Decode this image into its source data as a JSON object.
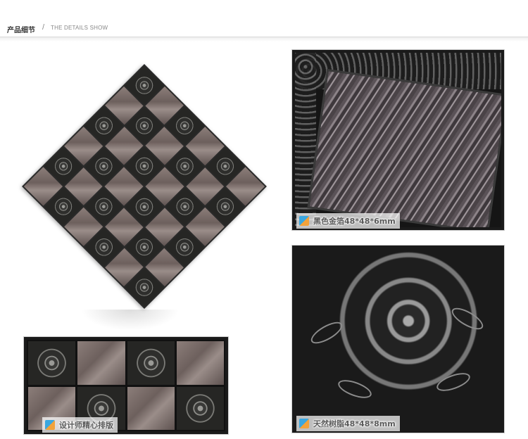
{
  "header": {
    "title_cn": "产品细节",
    "separator": "/",
    "title_en": "THE DETAILS SHOW"
  },
  "photos": {
    "top_right": {
      "caption": "黑色金箔48*48*6mm",
      "icon": "brand-square-icon"
    },
    "bottom_right": {
      "caption": "天然树脂48*48*8mm",
      "icon": "brand-square-icon"
    },
    "bottom_left": {
      "caption": "设计师精心排版",
      "icon": "brand-square-icon"
    }
  },
  "colors": {
    "dark_tile": "#2e2e2c",
    "light_tile": "#8c7e7a",
    "accent_blue": "#3aa7e0",
    "accent_orange": "#f2a23a"
  }
}
